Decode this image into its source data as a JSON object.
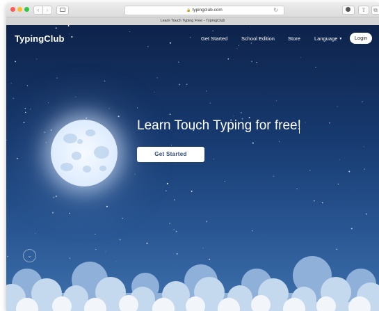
{
  "browser": {
    "address": "typingclub.com",
    "tab_title": "Learn Touch Typing Free - TypingClub",
    "icons": [
      "back-icon",
      "forward-icon",
      "sidebar-icon",
      "lock-icon",
      "reload-icon",
      "download-icon",
      "share-icon",
      "tabs-icon"
    ]
  },
  "nav": {
    "logo": "TypingClub",
    "links": [
      "Get Started",
      "School Edition",
      "Store",
      "Language"
    ],
    "login": "Login"
  },
  "hero": {
    "title": "Learn Touch Typing for free!",
    "cta": "Get Started"
  },
  "colors": {
    "sky_top": "#0e234a",
    "sky_bottom": "#3f72ad",
    "button_text": "#2d4a7a"
  }
}
